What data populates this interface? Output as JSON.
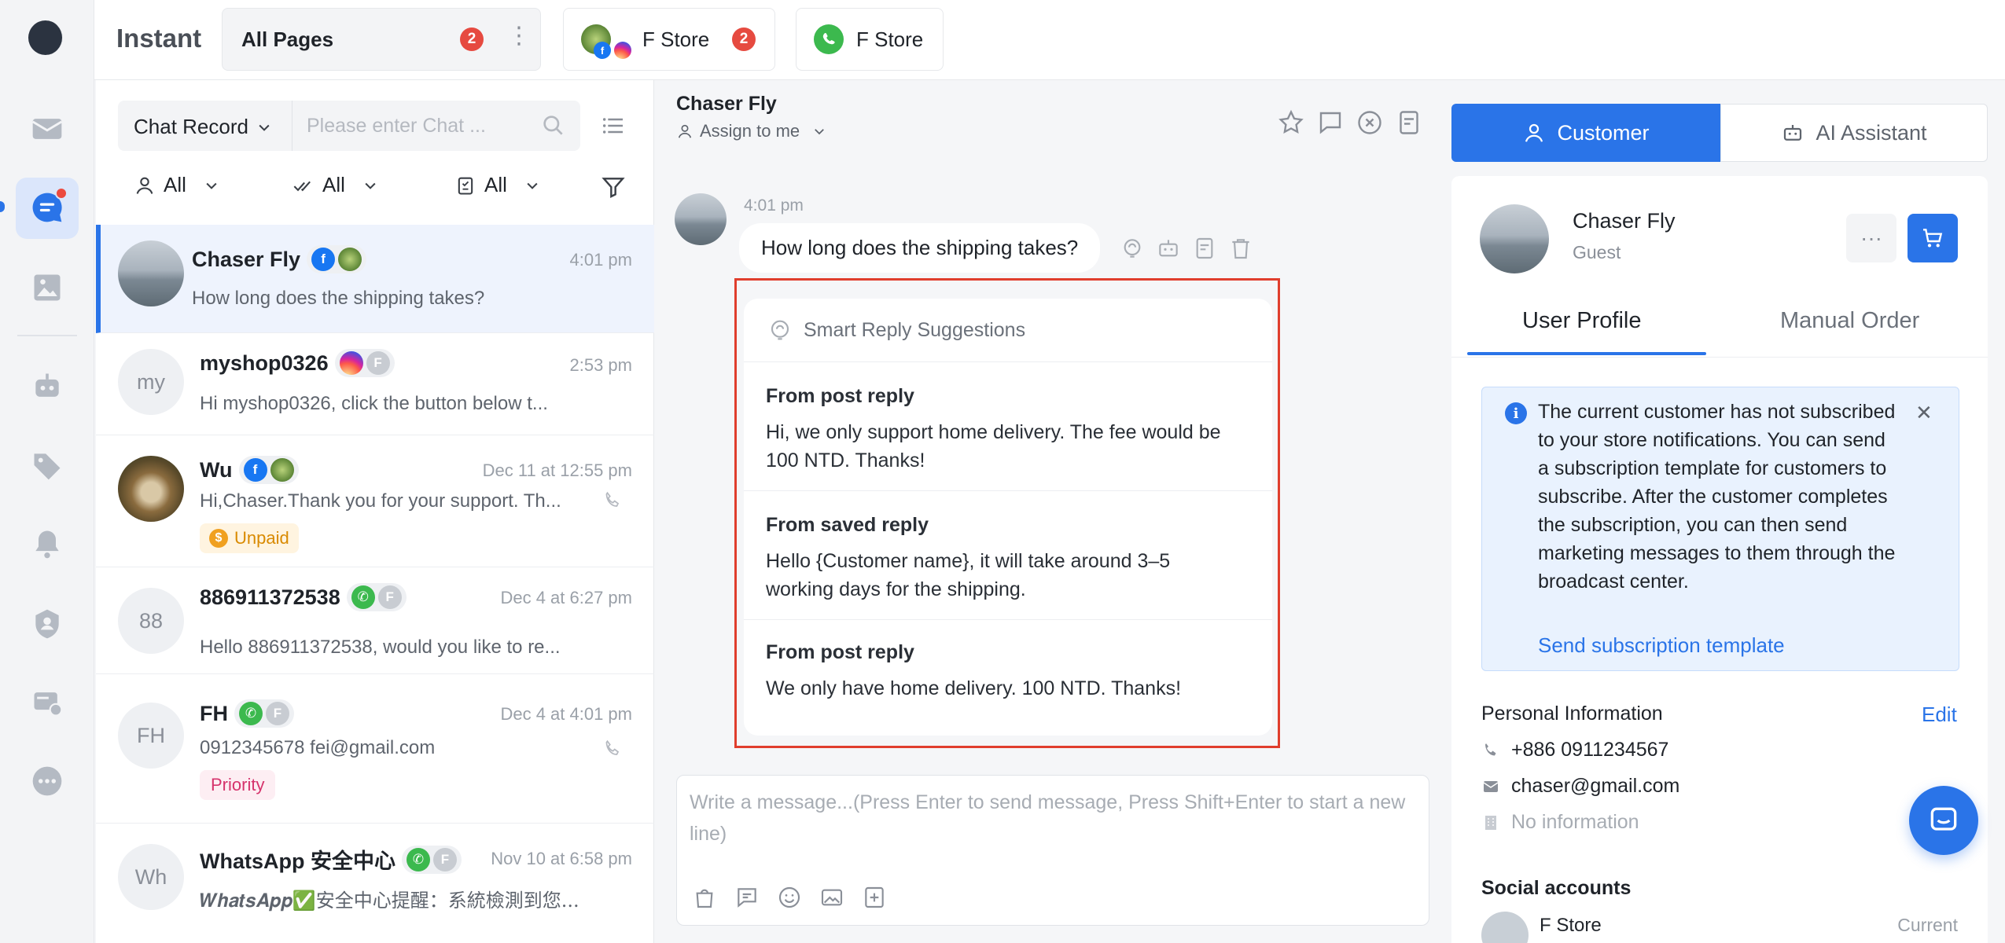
{
  "header": {
    "app_title": "Instant",
    "tab_all": {
      "label": "All Pages",
      "badge": "2"
    },
    "tab_store_1": {
      "label": "F Store",
      "badge": "2"
    },
    "tab_store_2": {
      "label": "F Store"
    }
  },
  "list": {
    "filter_label": "Chat Record",
    "search_placeholder": "Please enter Chat ...",
    "sub_filters": [
      "All",
      "All",
      "All"
    ],
    "conversations": [
      {
        "name": "Chaser Fly",
        "time": "4:01 pm",
        "preview": "How long does the shipping takes?"
      },
      {
        "name": "myshop0326",
        "avatar_text": "my",
        "time": "2:53 pm",
        "preview": "Hi myshop0326, click the button below t..."
      },
      {
        "name": "Wu",
        "time": "Dec 11 at 12:55 pm",
        "preview": "Hi,Chaser.Thank you for your support. Th...",
        "tag": "Unpaid",
        "coin": "$"
      },
      {
        "name": "886911372538",
        "avatar_text": "88",
        "time": "Dec 4 at 6:27 pm",
        "preview": "Hello 886911372538, would you like to re..."
      },
      {
        "name": "FH",
        "avatar_text": "FH",
        "time": "Dec 4 at 4:01 pm",
        "preview": "0912345678 fei@gmail.com",
        "tag": "Priority"
      },
      {
        "name": "WhatsApp 安全中心",
        "avatar_text": "Wh",
        "time": "Nov 10 at 6:58 pm",
        "preview": "𝑾𝒉𝒂𝒕𝒔𝑨𝒑𝒑✅安全中心提醒：系統檢測到您..."
      }
    ],
    "channel_f": "F"
  },
  "chat": {
    "contact_name": "Chaser Fly",
    "assign_label": "Assign to me",
    "message_time": "4:01 pm",
    "message_text": "How long does the shipping takes?",
    "suggestions": {
      "title": "Smart Reply Suggestions",
      "items": [
        {
          "source": "From post reply",
          "text": "Hi, we only support home delivery. The fee would be 100 NTD. Thanks!"
        },
        {
          "source": "From saved reply",
          "text": "Hello {Customer name}, it will take around 3–5 working days for the shipping."
        },
        {
          "source": "From post reply",
          "text": "We only have home delivery. 100 NTD. Thanks!"
        }
      ]
    },
    "composer_placeholder": "Write a message...(Press Enter to send message, Press Shift+Enter to start a new line)"
  },
  "right_panel": {
    "tab_customer": "Customer",
    "tab_ai": "AI Assistant",
    "customer_name": "Chaser Fly",
    "customer_role": "Guest",
    "more_label": "···",
    "profile_tabs": [
      "User Profile",
      "Manual Order"
    ],
    "notice": {
      "icon": "i",
      "text": "The current customer has not subscribed to your store notifications. You can send a subscription template for customers to subscribe. After the customer completes the subscription, you can then send marketing messages to them through the broadcast center.",
      "link": "Send subscription template",
      "close": "✕"
    },
    "personal_info_title": "Personal Information",
    "edit_label": "Edit",
    "phone": "+886 0911234567",
    "email": "chaser@gmail.com",
    "address": "No information",
    "social_title": "Social accounts",
    "social_first": "F Store",
    "social_first_status": "Current"
  },
  "colors": {
    "accent": "#2a74e8",
    "badge": "#e64a40",
    "highlight_frame": "#e03e2d"
  }
}
